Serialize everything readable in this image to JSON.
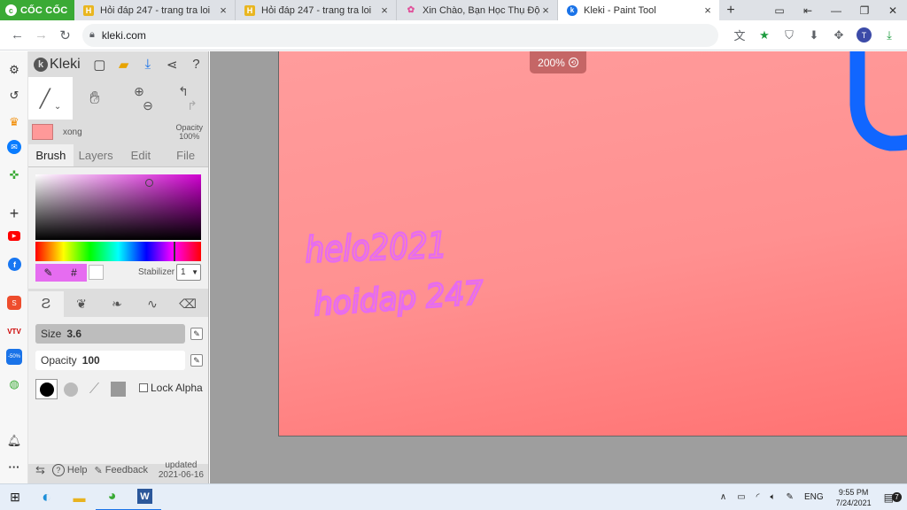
{
  "browser": {
    "brand": "CỐC CỐC",
    "tabs": [
      {
        "title": "Hỏi đáp 247 - trang tra loi",
        "favicon": "H"
      },
      {
        "title": "Hỏi đáp 247 - trang tra loi",
        "favicon": "H"
      },
      {
        "title": "Xin Chào, Bạn Học Thụ Động",
        "favicon": "flower-icon"
      },
      {
        "title": "Kleki - Paint Tool",
        "favicon": "kleki-icon",
        "active": true
      }
    ],
    "url": "kleki.com",
    "profile_initial": "T"
  },
  "kleki": {
    "logo": "Kleki",
    "layer": {
      "name": "xong",
      "opacity_label": "Opacity",
      "opacity_value": "100%"
    },
    "tabs": [
      "Brush",
      "Layers",
      "Edit",
      "File"
    ],
    "active_tab": "Brush",
    "color": {
      "primary": "#e66cf0",
      "secondary": "#ffffff",
      "hex_symbol": "#"
    },
    "stabilizer": {
      "label": "Stabilizer",
      "value": "1"
    },
    "size": {
      "label": "Size",
      "value": "3.6",
      "fraction": 0.12
    },
    "opacity": {
      "label": "Opacity",
      "value": "100",
      "fraction": 1.0
    },
    "lock_alpha": "Lock Alpha",
    "bottom": {
      "help": "Help",
      "feedback": "Feedback",
      "updated_label": "updated",
      "updated_date": "2021-06-16"
    }
  },
  "canvas": {
    "zoom": "200%",
    "background_color": "#ff9090",
    "handwriting_1": "helo2021",
    "handwriting_2": "hoidap 247",
    "stroke_colors": {
      "text": "#e66cf0",
      "shape": "#1166ff"
    }
  },
  "taskbar": {
    "lang": "ENG",
    "time": "9:55 PM",
    "date": "7/24/2021",
    "notif_count": "7"
  }
}
